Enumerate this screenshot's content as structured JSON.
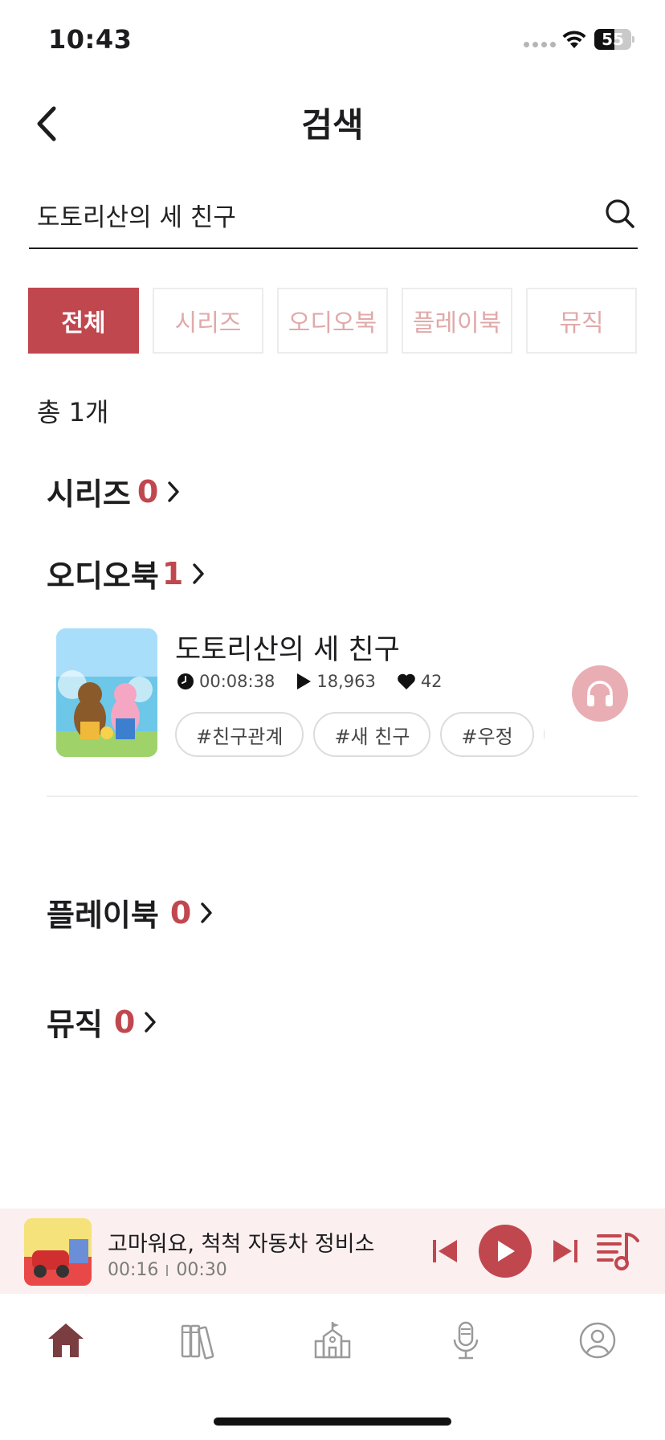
{
  "status_bar": {
    "time": "10:43",
    "battery": "55",
    "battery_level": 0.55
  },
  "header": {
    "title": "검색"
  },
  "search": {
    "value": "도토리산의 세 친구",
    "placeholder": ""
  },
  "tabs": [
    {
      "label": "전체",
      "active": true
    },
    {
      "label": "시리즈",
      "active": false
    },
    {
      "label": "오디오북",
      "active": false
    },
    {
      "label": "플레이북",
      "active": false
    },
    {
      "label": "뮤직",
      "active": false
    }
  ],
  "result_count": "총 1개",
  "sections": {
    "series": {
      "title": "시리즈",
      "count": "0"
    },
    "audiobook": {
      "title": "오디오북",
      "count": "1"
    },
    "playbook": {
      "title": "플레이북",
      "count": "0"
    },
    "music": {
      "title": "뮤직",
      "count": "0"
    }
  },
  "audiobook_item": {
    "title": "도토리산의 세 친구",
    "duration": "00:08:38",
    "plays": "18,963",
    "likes": "42",
    "tags": [
      "#친구관계",
      "#새 친구",
      "#우정",
      "#"
    ],
    "cover_text": "도토리산의 세 친구"
  },
  "player": {
    "title": "고마워요, 척척 자동차 정비소",
    "current_time": "00:16",
    "total_time": "00:30",
    "cover_text": "척척 자동차 정비소"
  },
  "colors": {
    "accent": "#c1474f",
    "accent_light": "#e9aeb3",
    "tab_inactive_text": "#e1a9a9",
    "player_bg": "#fcefef"
  },
  "nav": [
    "home-icon",
    "library-icon",
    "school-icon",
    "microphone-icon",
    "profile-icon"
  ]
}
